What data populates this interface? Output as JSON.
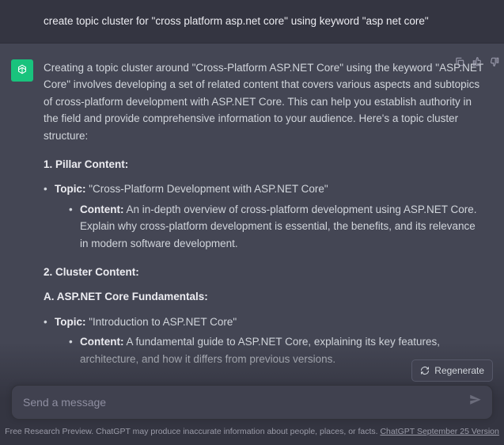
{
  "user": {
    "text": "create topic cluster for \"cross platform asp.net core\" using keyword \"asp net core\""
  },
  "assistant": {
    "intro": "Creating a topic cluster around \"Cross-Platform ASP.NET Core\" using the keyword \"ASP.NET Core\" involves developing a set of related content that covers various aspects and subtopics of cross-platform development with ASP.NET Core. This can help you establish authority in the field and provide comprehensive information to your audience. Here's a topic cluster structure:",
    "sec1": {
      "heading": "1. Pillar Content:",
      "topic_label": "Topic:",
      "topic_text": " \"Cross-Platform Development with ASP.NET Core\"",
      "content_label": "Content:",
      "content_text": " An in-depth overview of cross-platform development using ASP.NET Core. Explain why cross-platform development is essential, the benefits, and its relevance in modern software development."
    },
    "sec2": {
      "heading": "2. Cluster Content:",
      "subheading": "A. ASP.NET Core Fundamentals:",
      "topic_label": "Topic:",
      "topic_text": " \"Introduction to ASP.NET Core\"",
      "content_label": "Content:",
      "content_text": " A fundamental guide to ASP.NET Core, explaining its key features, architecture, and how it differs from previous versions."
    }
  },
  "controls": {
    "regenerate": "Regenerate",
    "input_placeholder": "Send a message"
  },
  "footer": {
    "text": "Free Research Preview. ChatGPT may produce inaccurate information about people, places, or facts. ",
    "link": "ChatGPT September 25 Version"
  }
}
